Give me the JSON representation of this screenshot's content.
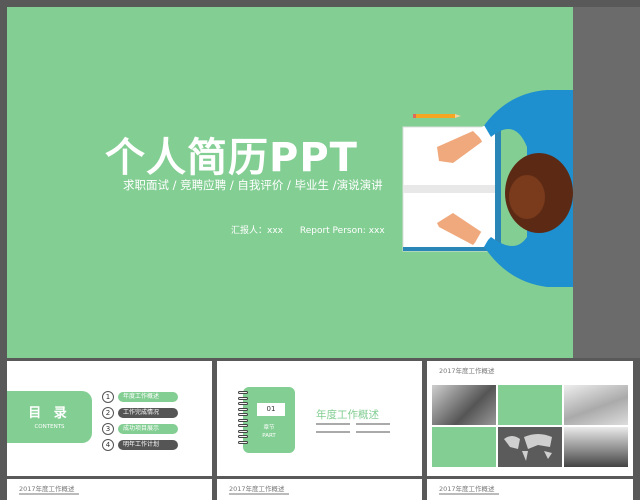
{
  "main_slide": {
    "title": "个人简历PPT",
    "subtitle": "求职面试 / 竞聘应聘 / 自我评价 / 毕业生 /演说演讲",
    "reporter_cn": "汇报人：xxx",
    "reporter_en": "Report Person: xxx"
  },
  "thumb1": {
    "title": "目 录",
    "subtitle": "CONTENTS",
    "items": [
      {
        "num": "1",
        "label": "年度工作概述"
      },
      {
        "num": "2",
        "label": "工作完成情况"
      },
      {
        "num": "3",
        "label": "成功项目展示"
      },
      {
        "num": "4",
        "label": "明年工作计划"
      }
    ]
  },
  "thumb2": {
    "number": "01",
    "label_cn": "章节",
    "label_en": "PART",
    "title": "年度工作概述"
  },
  "thumb3": {
    "title": "2017年度工作概述"
  },
  "bottom_thumbs": [
    "2017年度工作概述",
    "2017年度工作概述",
    "2017年度工作概述"
  ],
  "colors": {
    "accent": "#83ce93",
    "dark": "#555555",
    "background": "#595959"
  }
}
